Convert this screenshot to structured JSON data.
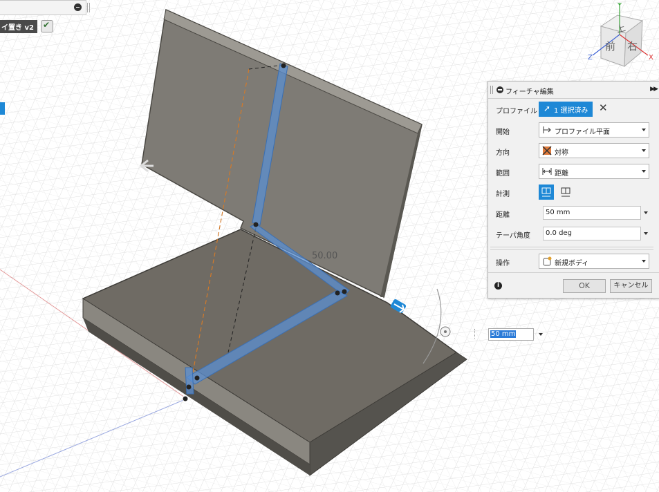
{
  "browser": {
    "document_name": "イ置き v2"
  },
  "viewport": {
    "dimension_label": "50.00",
    "float_input_value": "50 mm"
  },
  "viewcube": {
    "top": "上",
    "front": "前",
    "right": "右",
    "axis_x": "X",
    "axis_y": "Y",
    "axis_z": "Z"
  },
  "dialog": {
    "title": "フィーチャ編集",
    "rows": {
      "profile": {
        "label": "プロファイル",
        "value": "1 選択済み"
      },
      "start": {
        "label": "開始",
        "value": "プロファイル平面"
      },
      "direction": {
        "label": "方向",
        "value": "対称"
      },
      "extent": {
        "label": "範囲",
        "value": "距離"
      },
      "measure": {
        "label": "計測"
      },
      "distance": {
        "label": "距離",
        "value": "50 mm"
      },
      "taper": {
        "label": "テーパ角度",
        "value": "0.0 deg"
      },
      "operation": {
        "label": "操作",
        "value": "新規ボディ"
      }
    },
    "ok_label": "OK",
    "cancel_label": "キャンセル"
  },
  "colors": {
    "accent": "#1e88d6",
    "body_gray": "#77746d",
    "selection_blue": "#4f86c6"
  }
}
